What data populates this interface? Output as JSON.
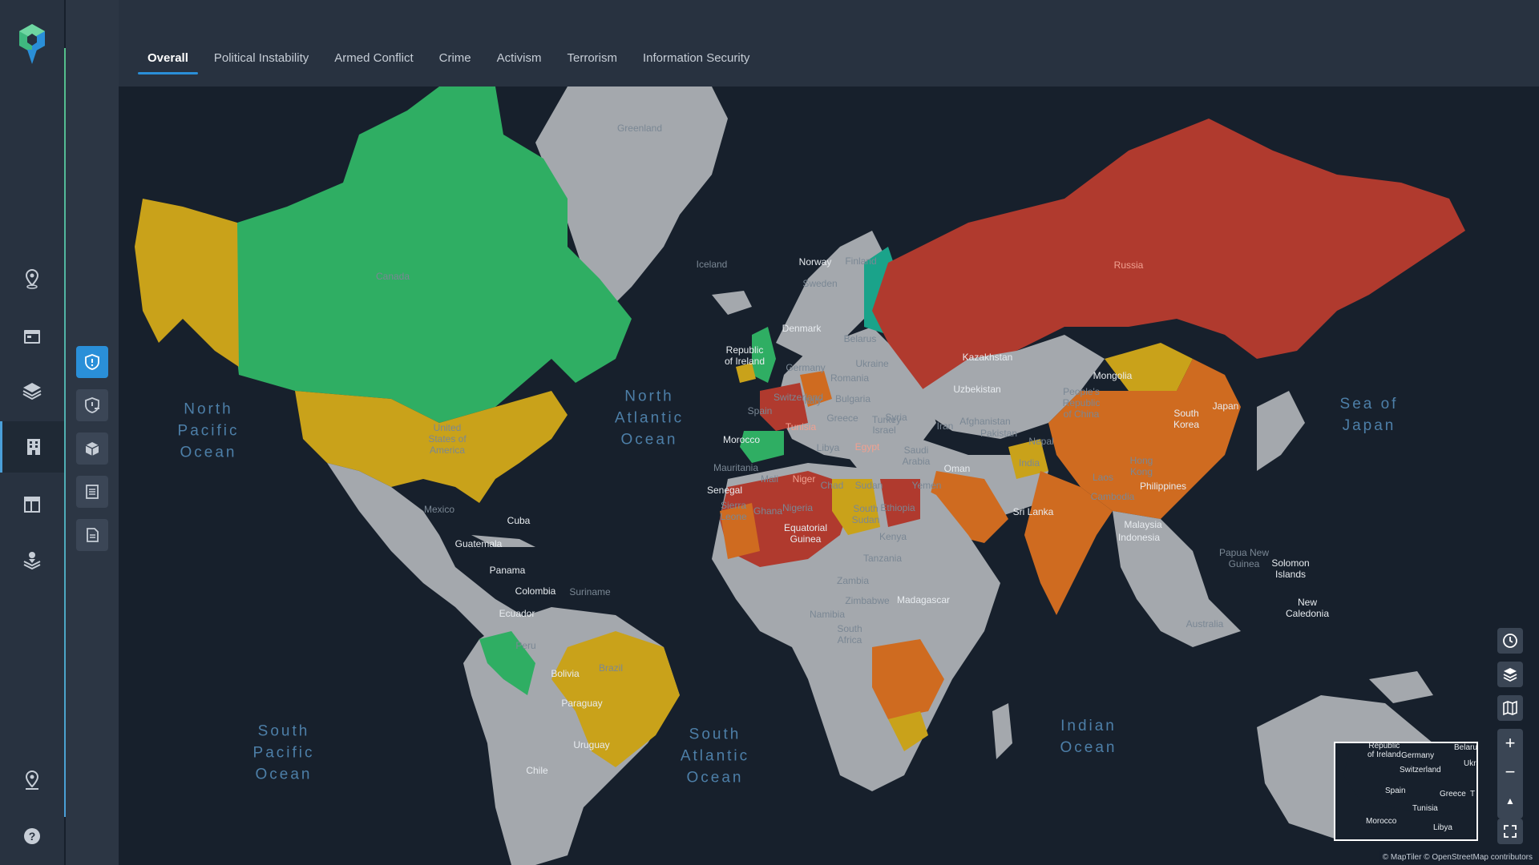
{
  "tabs": [
    "Overall",
    "Political Instability",
    "Armed Conflict",
    "Crime",
    "Activism",
    "Terrorism",
    "Information Security"
  ],
  "active_tab": "Overall",
  "rail_icons": [
    "map-pin-icon",
    "calendar-icon",
    "layers-icon",
    "building-icon",
    "layout-icon",
    "stack-pin-icon",
    "location-icon",
    "help-icon"
  ],
  "sub_icons": [
    "shield-alert-icon",
    "shield-list-icon",
    "box-icon",
    "list-doc-icon",
    "document-icon"
  ],
  "colors": {
    "low": "#2fae63",
    "lowest": "#1aa38a",
    "medium": "#c9a21a",
    "high": "#cf6b20",
    "extreme": "#b03a2e",
    "unrated": "#a4a8ad",
    "water": "#17202c",
    "accent": "#2a8fd8"
  },
  "oceans": {
    "north_pacific": "North\nPacific\nOcean",
    "north_atlantic": "North\nAtlantic\nOcean",
    "south_pacific": "South\nPacific\nOcean",
    "south_atlantic": "South\nAtlantic\nOcean",
    "indian": "Indian\nOcean",
    "sea_of_japan": "Sea of\nJapan"
  },
  "labels": {
    "greenland": "Greenland",
    "canada": "Canada",
    "usa": "United\nStates of\nAmerica",
    "mexico": "Mexico",
    "cuba": "Cuba",
    "guatemala": "Guatemala",
    "panama": "Panama",
    "colombia": "Colombia",
    "suriname": "Suriname",
    "ecuador": "Ecuador",
    "peru": "Peru",
    "brazil": "Brazil",
    "bolivia": "Bolivia",
    "paraguay": "Paraguay",
    "uruguay": "Uruguay",
    "chile": "Chile",
    "iceland": "Iceland",
    "norway": "Norway",
    "sweden": "Sweden",
    "finland": "Finland",
    "denmark": "Denmark",
    "ireland": "Republic\nof Ireland",
    "germany": "Germany",
    "belarus": "Belarus",
    "ukraine": "Ukraine",
    "switzerland": "Switzerland",
    "romania": "Romania",
    "italy": "Italy",
    "bulgaria": "Bulgaria",
    "spain": "Spain",
    "greece": "Greece",
    "turkey": "Turkey",
    "russia": "Russia",
    "kazakhstan": "Kazakhstan",
    "mongolia": "Mongolia",
    "uzbekistan": "Uzbekistan",
    "china": "People's\nRepublic\nof China",
    "south_korea": "South\nKorea",
    "japan": "Japan",
    "syria": "Syria",
    "israel": "Israel",
    "iran": "Iran",
    "afghanistan": "Afghanistan",
    "pakistan": "Pakistan",
    "nepal": "Nepal",
    "india": "India",
    "hong_kong": "Hong\nKong",
    "laos": "Laos",
    "philippines": "Philippines",
    "cambodia": "Cambodia",
    "sri_lanka": "Sri Lanka",
    "malaysia": "Malaysia",
    "indonesia": "Indonesia",
    "tunisia": "Tunisia",
    "morocco": "Morocco",
    "libya": "Libya",
    "egypt": "Egypt",
    "saudi": "Saudi\nArabia",
    "oman": "Oman",
    "yemen": "Yemen",
    "mauritania": "Mauritania",
    "mali": "Mali",
    "niger": "Niger",
    "chad": "Chad",
    "sudan": "Sudan",
    "senegal": "Senegal",
    "sierra_leone": "Sierra\nLeone",
    "ghana": "Ghana",
    "nigeria": "Nigeria",
    "south_sudan": "South\nSudan",
    "ethiopia": "Ethiopia",
    "eq_guinea": "Equatorial\nGuinea",
    "kenya": "Kenya",
    "tanzania": "Tanzania",
    "zambia": "Zambia",
    "zimbabwe": "Zimbabwe",
    "madagascar": "Madagascar",
    "namibia": "Namibia",
    "south_africa": "South\nAfrica",
    "png": "Papua New\nGuinea",
    "solomon": "Solomon\nIslands",
    "new_caledonia": "New\nCaledonia",
    "australia": "Australia"
  },
  "minimap": {
    "ireland": "Republic\nof Ireland",
    "germany": "Germany",
    "belarus": "Belaru",
    "ukraine": "Ukra",
    "switzerland": "Switzerland",
    "spain": "Spain",
    "greece": "Greece",
    "tunisia": "Tunisia",
    "morocco": "Morocco",
    "libya": "Libya",
    "edge": "T"
  },
  "controls": [
    "clock-icon",
    "layers-icon",
    "map-icon"
  ],
  "zoom": {
    "in": "+",
    "out": "−",
    "reset": "▲"
  },
  "attribution": "© MapTiler © OpenStreetMap contributors"
}
